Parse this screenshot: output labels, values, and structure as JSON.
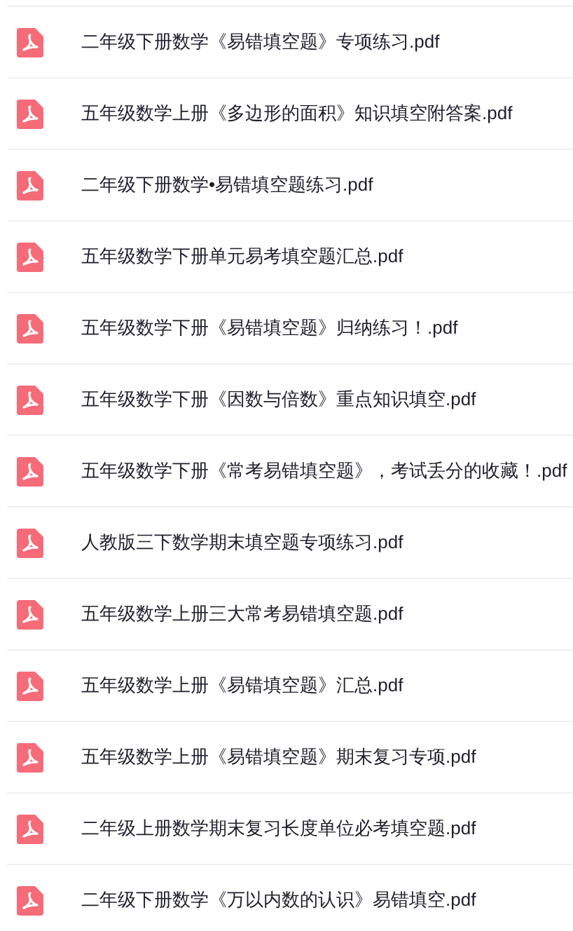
{
  "files": [
    {
      "name": "二年级下册数学《易错填空题》专项练习.pdf"
    },
    {
      "name": "五年级数学上册《多边形的面积》知识填空附答案.pdf"
    },
    {
      "name": "二年级下册数学•易错填空题练习.pdf"
    },
    {
      "name": "五年级数学下册单元易考填空题汇总.pdf"
    },
    {
      "name": "五年级数学下册《易错填空题》归纳练习！.pdf"
    },
    {
      "name": "五年级数学下册《因数与倍数》重点知识填空.pdf"
    },
    {
      "name": "五年级数学下册《常考易错填空题》，考试丢分的收藏！.pdf"
    },
    {
      "name": "人教版三下数学期末填空题专项练习.pdf"
    },
    {
      "name": "五年级数学上册三大常考易错填空题.pdf"
    },
    {
      "name": "五年级数学上册《易错填空题》汇总.pdf"
    },
    {
      "name": "五年级数学上册《易错填空题》期末复习专项.pdf"
    },
    {
      "name": "二年级上册数学期末复习长度单位必考填空题.pdf"
    },
    {
      "name": "二年级下册数学《万以内数的认识》易错填空.pdf"
    }
  ]
}
